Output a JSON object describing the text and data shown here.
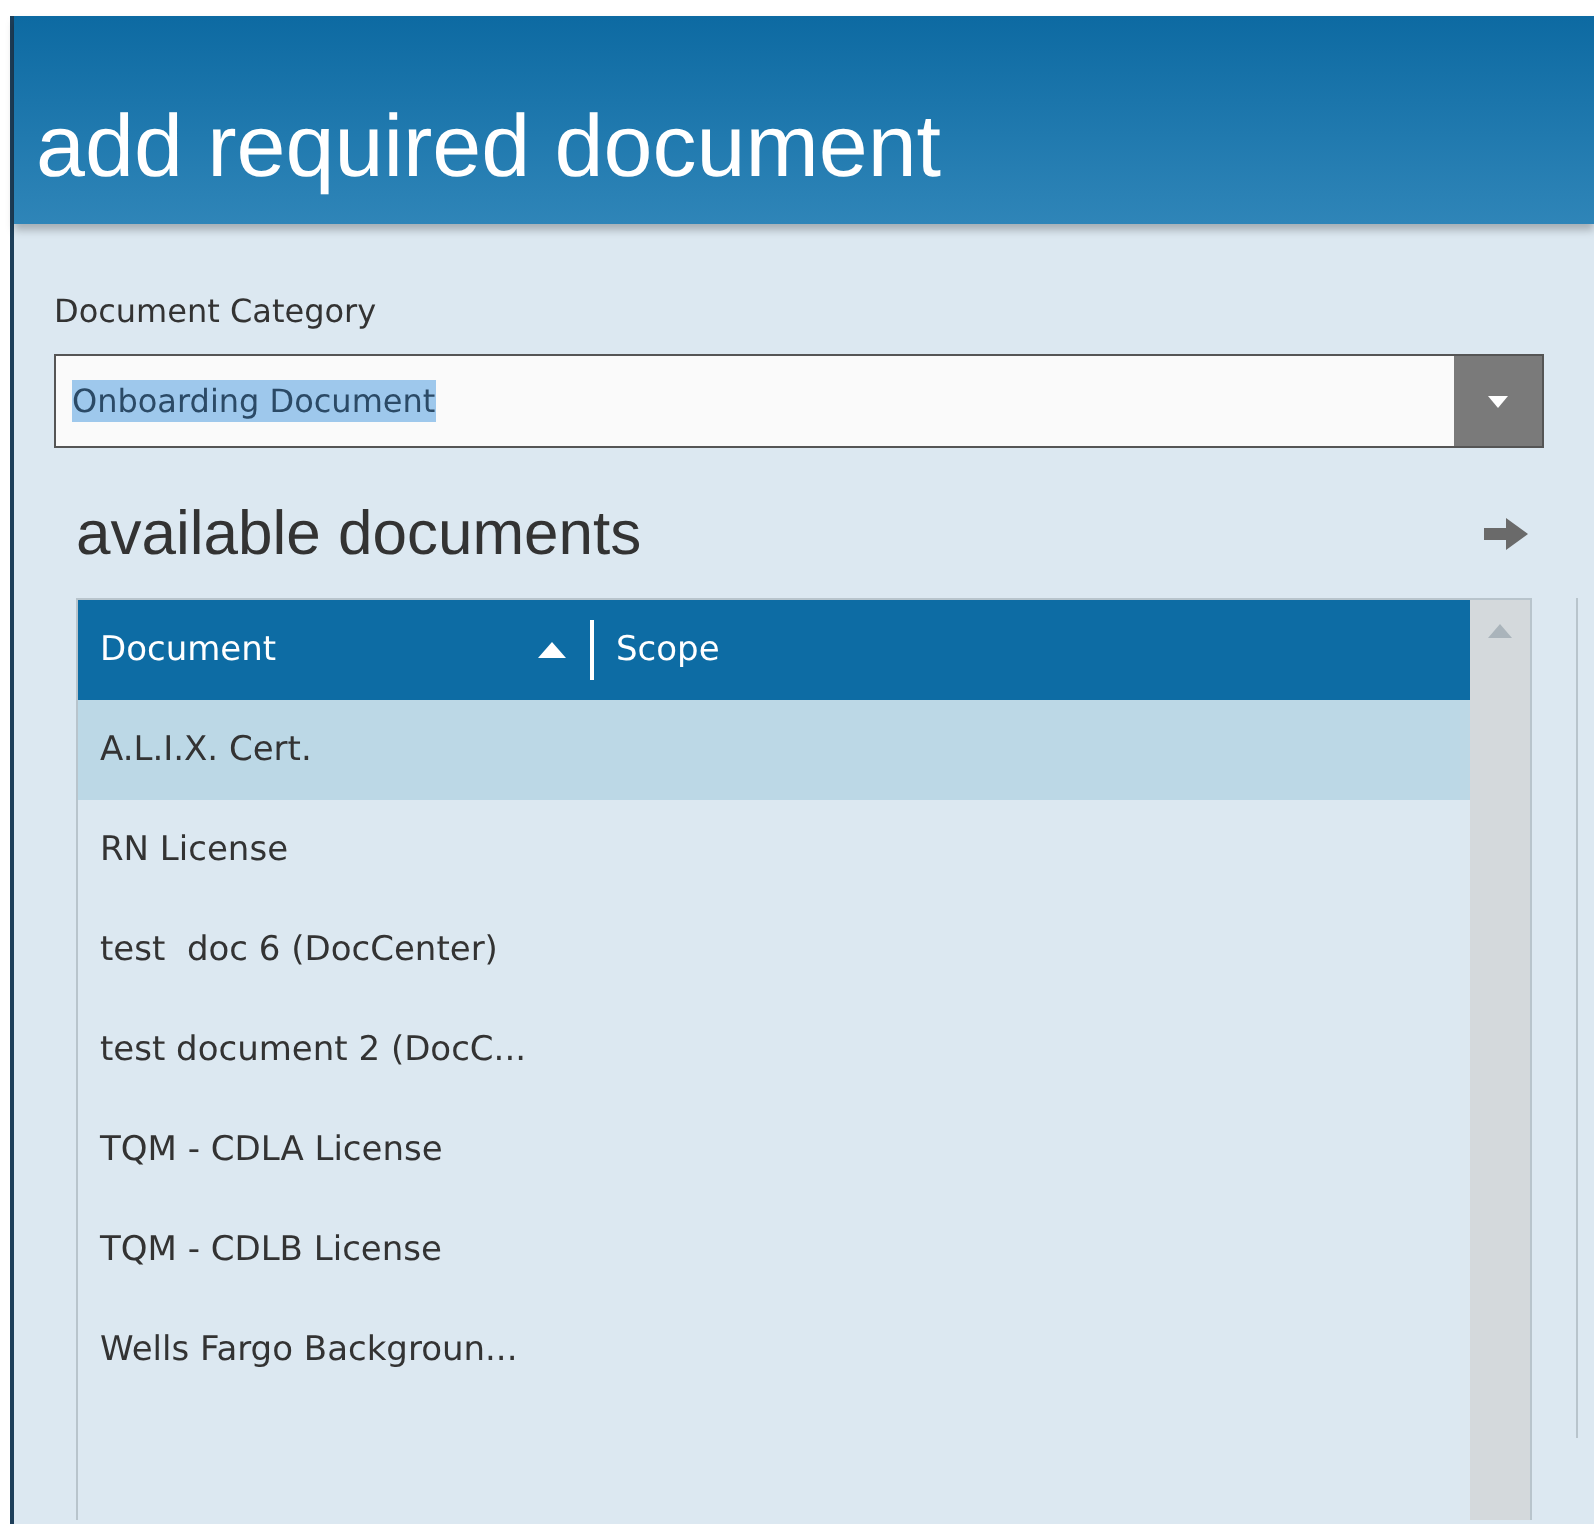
{
  "dialog": {
    "title": "add required document"
  },
  "category": {
    "label": "Document Category",
    "value": "Onboarding Document",
    "value_highlighted": true
  },
  "available": {
    "heading": "available documents",
    "columns": [
      {
        "label": "Document",
        "sorted": true
      },
      {
        "label": "Scope",
        "sorted": false
      }
    ],
    "rows": [
      {
        "document": "A.L.I.X. Cert.",
        "selected": true
      },
      {
        "document": "RN License",
        "selected": false
      },
      {
        "document": "test  doc 6 (DocCenter)",
        "selected": false
      },
      {
        "document": "test document 2 (DocC...",
        "selected": false
      },
      {
        "document": "TQM - CDLA License",
        "selected": false
      },
      {
        "document": "TQM - CDLB License",
        "selected": false
      },
      {
        "document": "Wells Fargo Backgroun...",
        "selected": false
      }
    ]
  }
}
